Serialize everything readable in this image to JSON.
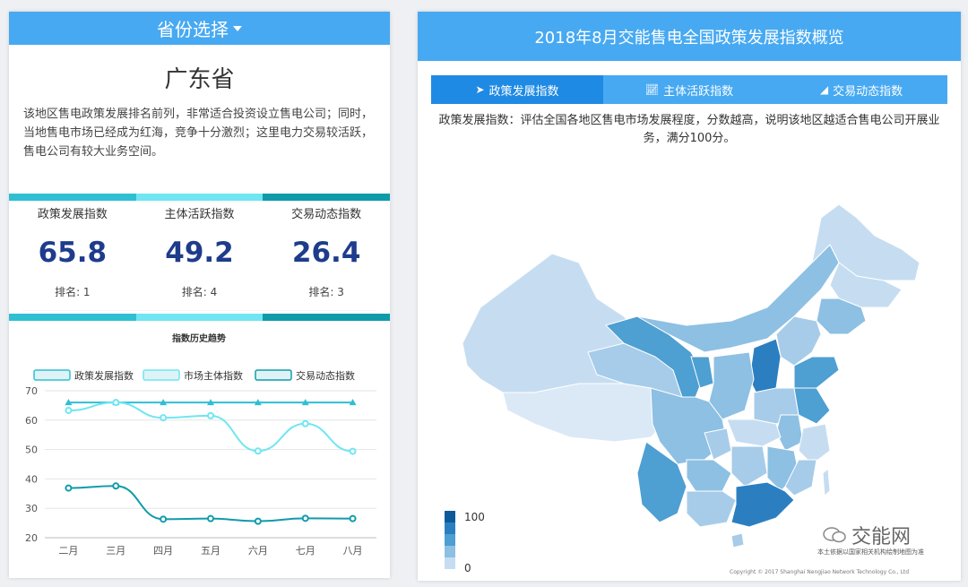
{
  "left": {
    "header": "省份选择",
    "province": "广东省",
    "description": "该地区售电政策发展排名前列，非常适合投资设立售电公司；同时，当地售电市场已经成为红海，竞争十分激烈；这里电力交易较活跃，售电公司有较大业务空间。",
    "indices": [
      {
        "label": "政策发展指数",
        "value": "65.8",
        "rank": "排名: 1"
      },
      {
        "label": "主体活跃指数",
        "value": "49.2",
        "rank": "排名: 4"
      },
      {
        "label": "交易动态指数",
        "value": "26.4",
        "rank": "排名: 3"
      }
    ]
  },
  "right": {
    "title": "2018年8月交能售电全国政策发展指数概览",
    "tabs": [
      {
        "label": "政策发展指数",
        "icon": "paper-plane-icon"
      },
      {
        "label": "主体活跃指数",
        "icon": "line-chart-icon"
      },
      {
        "label": "交易动态指数",
        "icon": "area-chart-icon"
      }
    ],
    "description": "政策发展指数：评估全国各地区售电市场发展程度，分数越高，说明该地区越适合售电公司开展业务，满分100分。",
    "legend_max": "100",
    "legend_min": "0",
    "legend_colors": [
      "#0d5a9b",
      "#2b7fc0",
      "#4e9fd2",
      "#8dc0e3",
      "#c6ddf1"
    ],
    "watermark": "交能网",
    "map_note": "本土依据以国家相关机构绘制地图为准",
    "copyright": "Copyright © 2017 Shanghai Nengjiao Network Technology Co., Ltd"
  },
  "chart_data": {
    "type": "line",
    "title": "指数历史趋势",
    "categories": [
      "二月",
      "三月",
      "四月",
      "五月",
      "六月",
      "七月",
      "八月"
    ],
    "ylim": [
      20,
      70
    ],
    "yticks": [
      20,
      30,
      40,
      50,
      60,
      70
    ],
    "grid": true,
    "legend_position": "top",
    "series": [
      {
        "name": "政策发展指数",
        "color": "#2fbfd3",
        "marker": "triangle",
        "values": [
          66,
          66,
          66,
          66,
          66,
          66,
          66
        ]
      },
      {
        "name": "市场主体指数",
        "color": "#6fe6f2",
        "marker": "circle",
        "values": [
          63.3,
          66,
          60.8,
          61.5,
          49.5,
          58.8,
          49.4
        ]
      },
      {
        "name": "交易动态指数",
        "color": "#109bab",
        "marker": "circle",
        "values": [
          36.9,
          37.6,
          26.3,
          26.5,
          25.6,
          26.6,
          26.5
        ]
      }
    ]
  }
}
